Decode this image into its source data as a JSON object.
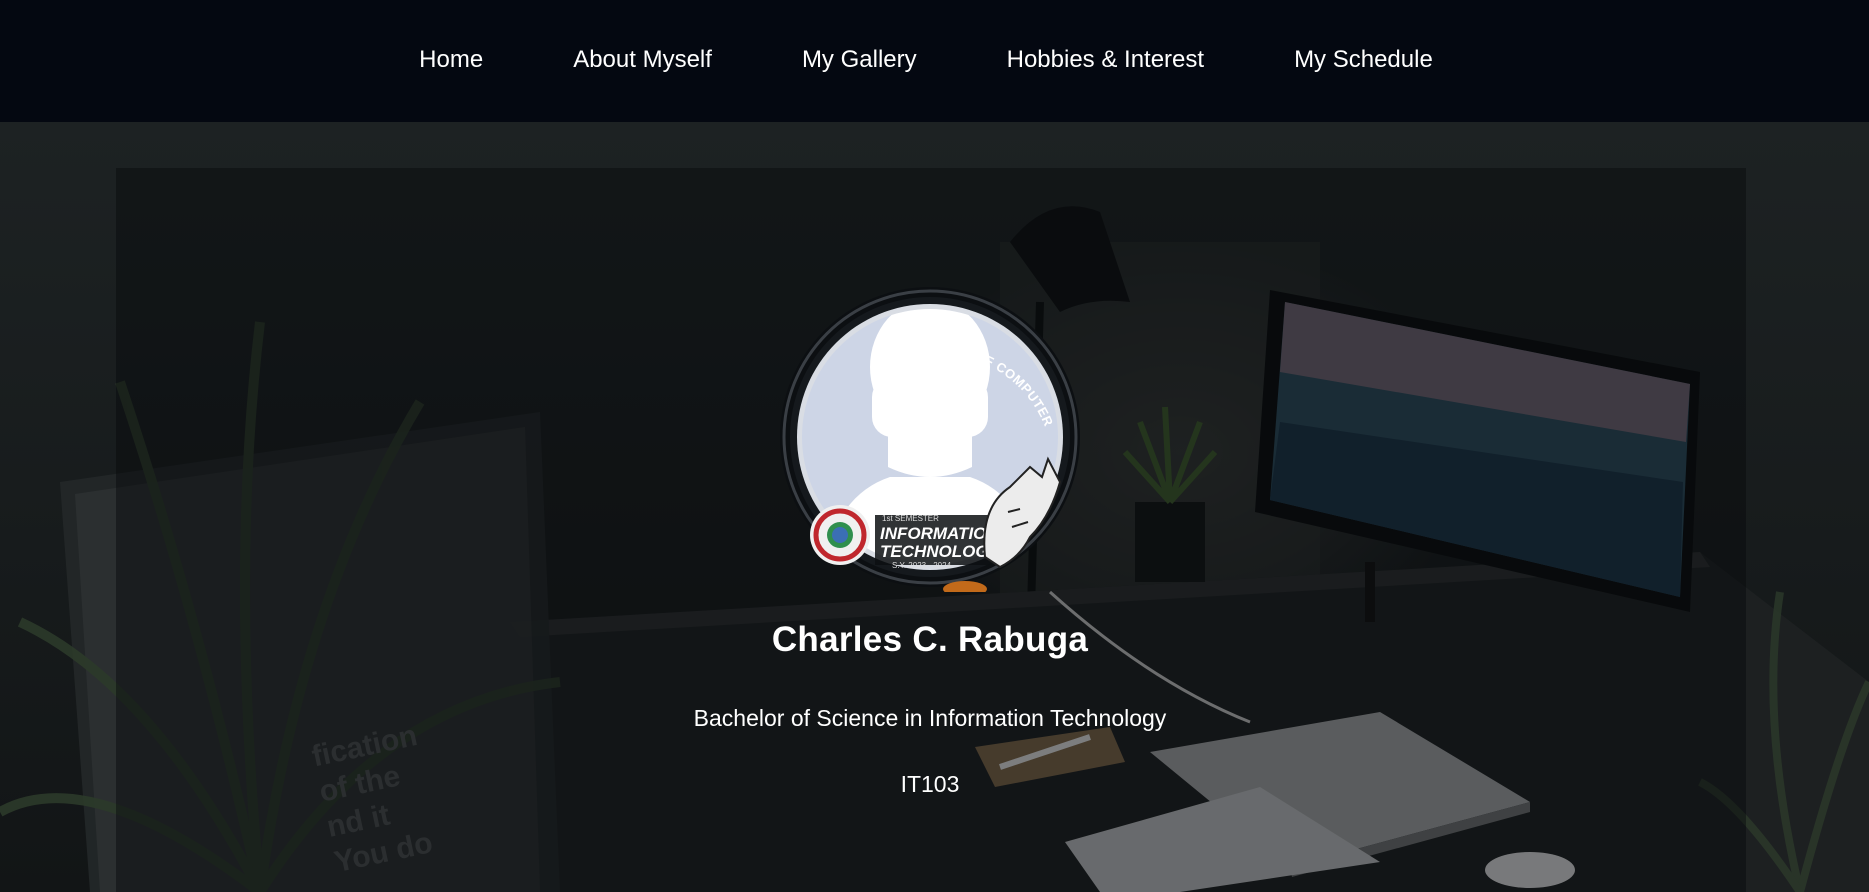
{
  "nav": {
    "items": [
      {
        "label": "Home"
      },
      {
        "label": "About Myself"
      },
      {
        "label": "My Gallery"
      },
      {
        "label": "Hobbies & Interest"
      },
      {
        "label": "My Schedule"
      }
    ]
  },
  "profile": {
    "name": "Charles C. Rabuga",
    "degree": "Bachelor of Science in Information Technology",
    "section": "IT103",
    "frame": {
      "top_text": "COLLEGE OF COMPUTER STUDIES",
      "badge_line1": "INFORMATION",
      "badge_line2": "TECHNOLOGY",
      "badge_small": "1st SEMESTER",
      "badge_year": "S.Y. 2023 - 2024"
    }
  },
  "background": {
    "poster_text": "fication\nof the\nnd it\nYou do"
  },
  "colors": {
    "navbar": "#040811",
    "page_bg": "#1a1e1f",
    "avatar_bg": "#cdd5e6"
  }
}
